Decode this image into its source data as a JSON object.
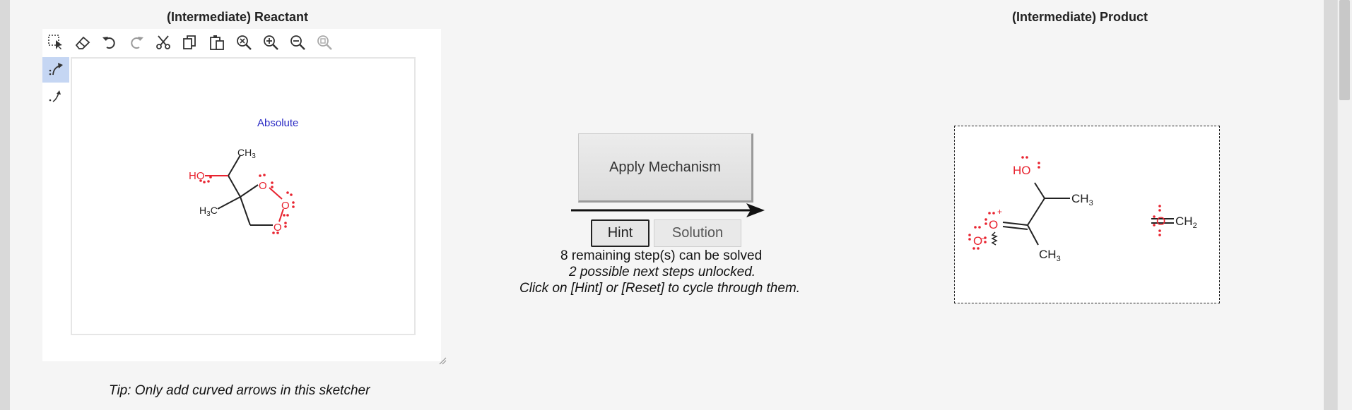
{
  "reactant_panel": {
    "heading": "(Intermediate) Reactant",
    "toolbar": {
      "items": [
        {
          "name": "select-icon"
        },
        {
          "name": "eraser-icon"
        },
        {
          "name": "undo-icon"
        },
        {
          "name": "redo-icon"
        },
        {
          "name": "cut-icon"
        },
        {
          "name": "copy-icon"
        },
        {
          "name": "paste-icon"
        },
        {
          "name": "zoom-reset-icon"
        },
        {
          "name": "zoom-in-icon"
        },
        {
          "name": "zoom-out-icon"
        },
        {
          "name": "zoom-fit-icon"
        }
      ]
    },
    "side_tools": [
      {
        "name": "curved-arrow-electron-pair-icon",
        "active": true
      },
      {
        "name": "curved-arrow-single-electron-icon",
        "active": false
      }
    ],
    "canvas": {
      "stereo_label": "Absolute",
      "labels": {
        "ch3": "CH",
        "ch3_sub": "3",
        "ho": "HO",
        "h3c_h": "H",
        "h3c_sub": "3",
        "h3c_c": "C",
        "o_ring_1": "O",
        "o_ring_2": "O",
        "o_ring_3": "O"
      }
    },
    "tip": "Tip: Only add curved arrows in this sketcher"
  },
  "mechanism": {
    "apply_label": "Apply Mechanism",
    "hint_label": "Hint",
    "solution_label": "Solution",
    "status_line_1": "8 remaining step(s) can be solved",
    "status_line_2": "2 possible next steps unlocked.",
    "status_line_3": "Click on [Hint] or [Reset] to cycle through them."
  },
  "product_panel": {
    "heading": "(Intermediate) Product",
    "labels": {
      "ho": "HO",
      "ch3_top": "CH",
      "ch3_top_sub": "3",
      "ch3_bottom": "CH",
      "ch3_bottom_sub": "3",
      "o_plus": "O",
      "plus": "+",
      "o_minus": "O",
      "minus": "−",
      "o_formaldehyde": "O",
      "ch2": "CH",
      "ch2_sub": "2"
    }
  },
  "colors": {
    "atom_red": "#e8232f",
    "bond_black": "#222222",
    "stereo_blue": "#2a2ac4",
    "active_tool": "#c5d6f3"
  }
}
